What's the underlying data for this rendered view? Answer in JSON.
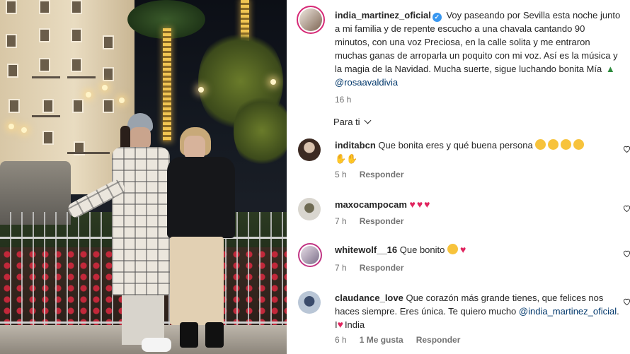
{
  "post": {
    "author": "india_martinez_oficial",
    "caption": "Voy paseando por Sevilla esta noche junto a mi familia y de repente escucho a una chavala cantando 90 minutos, con una voz Preciosa, en la calle solita y me entraron muchas ganas de arroparla un poquito con mi voz. Así es la música y la magia de la Navidad. Mucha suerte, sigue luchando bonita Mía",
    "caption_mention": "@rosaavaldivia",
    "time": "16 h",
    "verified_icon": "verified-badge-icon",
    "tree_icon": "christmas-tree-icon"
  },
  "filter": {
    "label": "Para ti",
    "icon": "chevron-down-icon"
  },
  "comments": [
    {
      "username": "inditabcn",
      "text": "Que bonita eres y qué buena persona",
      "emoji_icons": [
        "kissing-face-icon",
        "kissing-face-icon",
        "kissing-face-icon",
        "kissing-face-icon"
      ],
      "second_line_icons": [
        "raising-hands-icon",
        "raising-hands-icon"
      ],
      "time": "5 h",
      "reply": "Responder"
    },
    {
      "username": "maxocampocam",
      "text": "",
      "emoji_icons": [
        "red-heart-icon",
        "red-heart-icon",
        "red-heart-icon"
      ],
      "time": "7 h",
      "reply": "Responder"
    },
    {
      "username": "whitewolf__16",
      "text": "Que bonito",
      "emoji_icons": [
        "heart-eyes-icon",
        "red-heart-icon"
      ],
      "time": "7 h",
      "reply": "Responder"
    },
    {
      "username": "claudance_love",
      "text": "Que corazón más grande tienes, que felices nos haces siempre. Eres única. Te quiero mucho",
      "mention": "@india_martinez_oficial",
      "tail_before": ". I",
      "tail_after": "India",
      "time": "6 h",
      "likes": "1 Me gusta",
      "reply": "Responder"
    }
  ],
  "colors": {
    "text": "#262626",
    "secondary": "#737373",
    "link": "#00376b",
    "verified": "#3897f0",
    "heart": "#e0245e",
    "story_ring": "#d62976"
  }
}
